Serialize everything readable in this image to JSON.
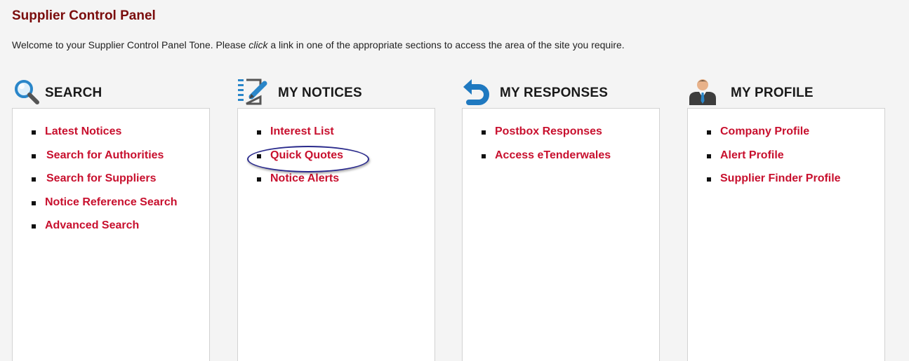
{
  "page": {
    "title": "Supplier Control Panel",
    "welcome_before": "Welcome to your Supplier Control Panel Tone. Please ",
    "welcome_emph": "click",
    "welcome_after": " a link in one of the appropriate sections to access the area of the site you require."
  },
  "colors": {
    "title": "#7a0c0c",
    "link": "#c8102e",
    "highlight": "#2a2a8c"
  },
  "sections": [
    {
      "title": "SEARCH",
      "icon": "magnifier-icon",
      "links": [
        "Latest Notices",
        "Search for Authorities",
        "Search for Suppliers",
        "Notice Reference Search",
        "Advanced Search"
      ]
    },
    {
      "title": "MY NOTICES",
      "icon": "notepad-pencil-icon",
      "links": [
        "Interest List",
        "Quick Quotes",
        "Notice Alerts"
      ]
    },
    {
      "title": "MY RESPONSES",
      "icon": "return-arrow-icon",
      "links": [
        "Postbox Responses",
        "Access eTenderwales"
      ]
    },
    {
      "title": "MY PROFILE",
      "icon": "user-profile-icon",
      "links": [
        "Company Profile",
        "Alert Profile",
        "Supplier Finder Profile"
      ]
    }
  ],
  "highlighted_link": "Quick Quotes"
}
